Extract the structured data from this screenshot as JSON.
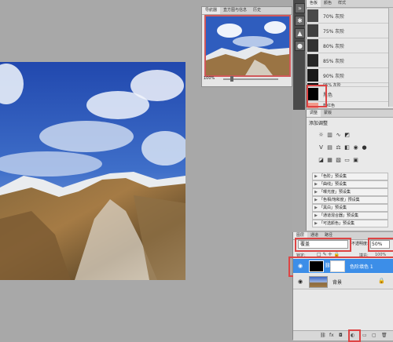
{
  "navigator": {
    "tabs": [
      "导航器",
      "直方图与信息",
      "历史"
    ],
    "zoom": "100%"
  },
  "swatches": {
    "tabs": [
      "色板",
      "颜色",
      "样式"
    ],
    "items": [
      {
        "label": "70% 灰阶",
        "color": "#4a4a4a"
      },
      {
        "label": "75% 灰阶",
        "color": "#404040"
      },
      {
        "label": "80% 灰阶",
        "color": "#333333"
      },
      {
        "label": "85% 灰阶",
        "color": "#262626"
      },
      {
        "label": "90% 灰阶",
        "color": "#1a1a1a"
      },
      {
        "label": "95% 灰阶",
        "color": "#0d0d0d"
      },
      {
        "label": "黑色",
        "color": "#000000"
      },
      {
        "label": "粉红色",
        "color": "#f39a8a"
      }
    ]
  },
  "adjustments": {
    "tabs": [
      "调整",
      "蒙版"
    ],
    "title": "添加调整",
    "presets": [
      "「色阶」预设集",
      "「曲线」预设集",
      "「曝光度」预设集",
      "「色相/饱和度」预设集",
      "「黑白」预设集",
      "「通道混合器」预设集",
      "「可选颜色」预设集"
    ]
  },
  "layers": {
    "tabs": [
      "图层",
      "通道",
      "路径"
    ],
    "blend_mode": "覆盖",
    "opacity_label": "不透明度:",
    "opacity": "50%",
    "lock_label": "锁定:",
    "fill_label": "填充:",
    "fill": "100%",
    "items": [
      {
        "name": "色阶填色 1"
      },
      {
        "name": "背景"
      }
    ]
  },
  "colors": {
    "highlight": "#d44444",
    "selection": "#3c8ee8"
  }
}
